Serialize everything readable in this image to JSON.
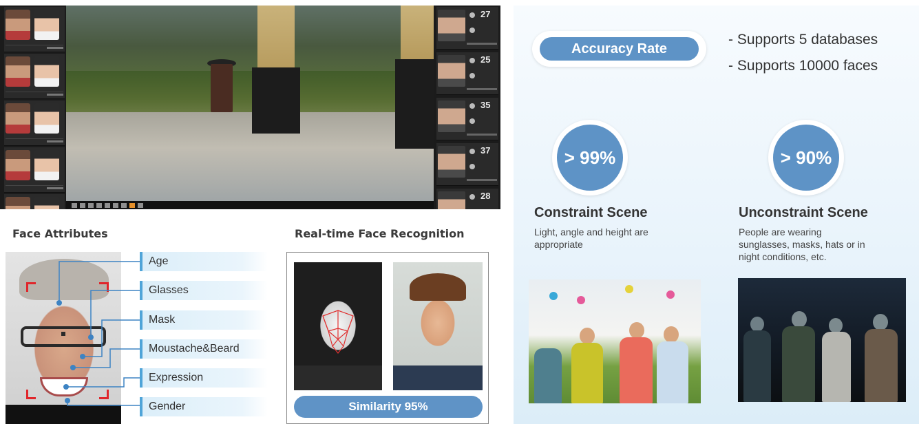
{
  "surveillance": {
    "left_cards": 5,
    "right_cards": [
      {
        "age": "27"
      },
      {
        "age": "25"
      },
      {
        "age": "35"
      },
      {
        "age": "37"
      },
      {
        "age": "28"
      }
    ]
  },
  "face_attributes": {
    "title": "Face Attributes",
    "items": [
      "Age",
      "Glasses",
      "Mask",
      "Moustache&Beard",
      "Expression",
      "Gender"
    ]
  },
  "recognition": {
    "title": "Real-time Face Recognition",
    "similarity": "Similarity 95%"
  },
  "accuracy": {
    "pill_label": "Accuracy Rate",
    "supports": [
      "- Supports 5 databases",
      "- Supports 10000 faces"
    ],
    "scenes": [
      {
        "rate": "> 99%",
        "title": "Constraint Scene",
        "desc_lines": [
          "Light, angle and height are",
          "appropriate"
        ]
      },
      {
        "rate": "> 90%",
        "title": "Unconstraint Scene",
        "desc_lines": [
          "People are wearing",
          "sunglasses, masks, hats or in",
          "night conditions, etc."
        ]
      }
    ]
  },
  "colors": {
    "accent": "#5e93c6",
    "bracket": "#e0262b",
    "attribute_bar": "#dbeef9"
  }
}
